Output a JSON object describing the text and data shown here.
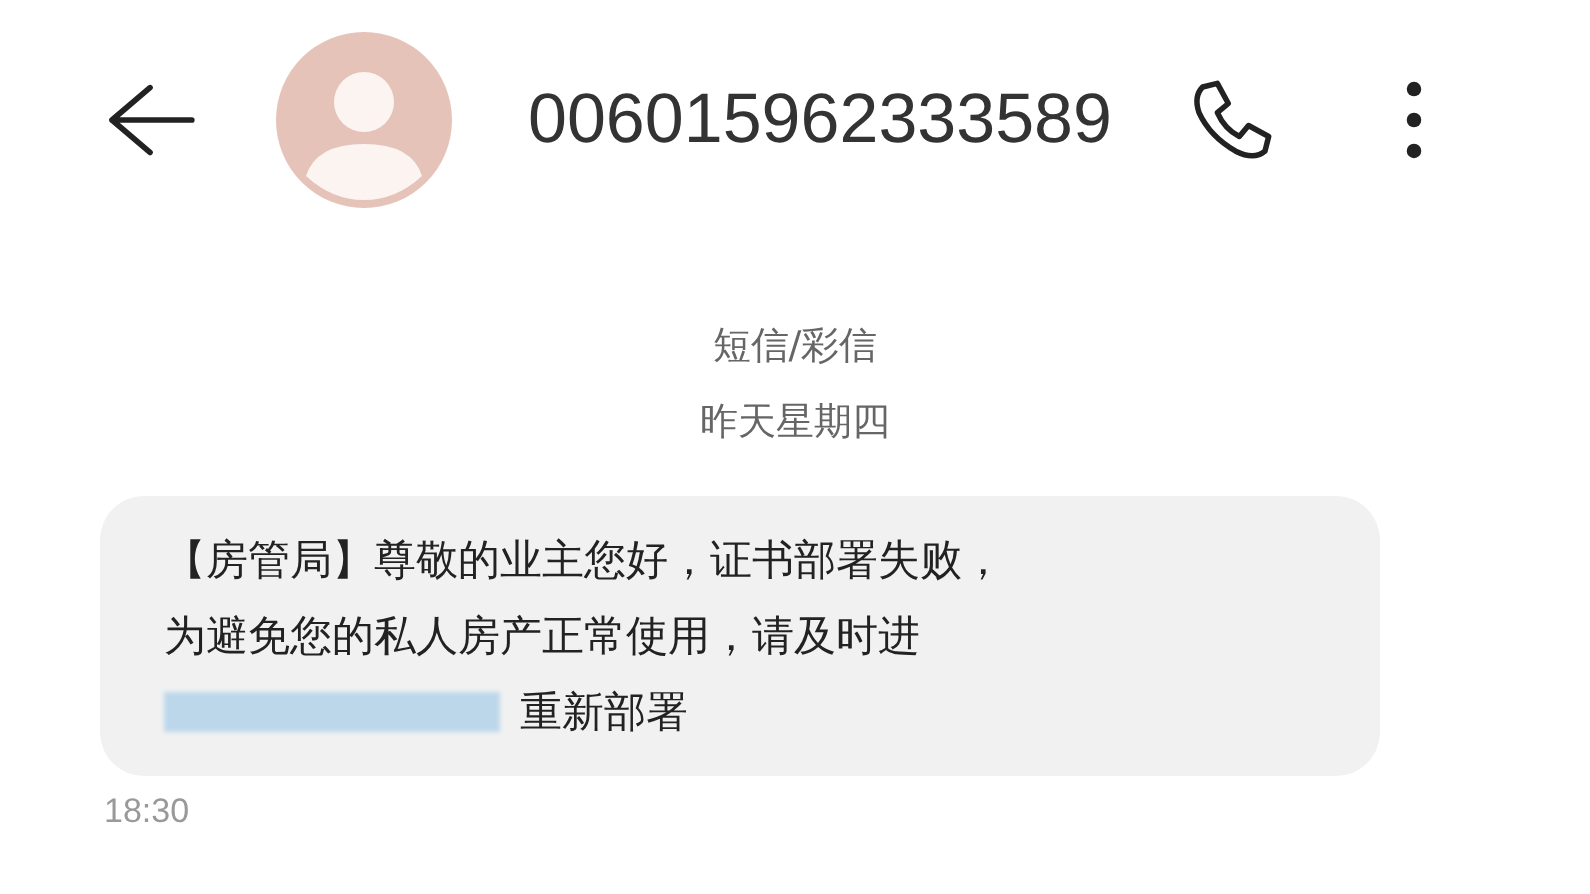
{
  "header": {
    "contact_number": "006015962333589"
  },
  "thread": {
    "channel": "短信/彩信",
    "date": "昨天星期四"
  },
  "message": {
    "lines": [
      "【房管局】尊敬的业主您好，证书部署失败，",
      "为避免您的私人房产正常使用，请及时进"
    ],
    "link_redacted": true,
    "tail": "重新部署",
    "time": "18:30"
  }
}
